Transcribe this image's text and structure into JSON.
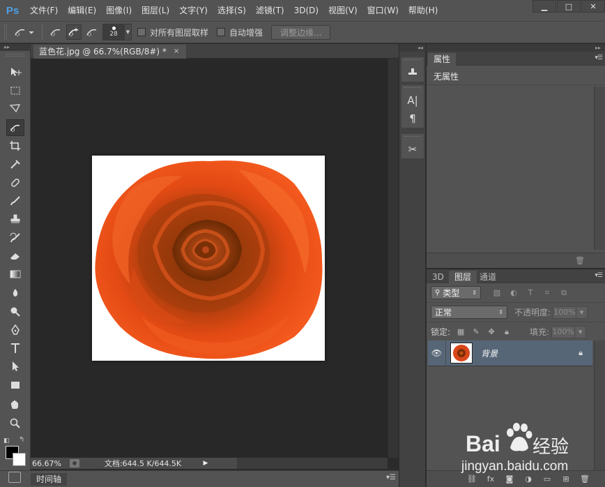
{
  "app": {
    "logo": "Ps"
  },
  "menu": [
    "文件(F)",
    "编辑(E)",
    "图像(I)",
    "图层(L)",
    "文字(Y)",
    "选择(S)",
    "滤镜(T)",
    "3D(D)",
    "视图(V)",
    "窗口(W)",
    "帮助(H)"
  ],
  "window_controls": {
    "minimize": "▁",
    "maximize": "□",
    "close": "✕"
  },
  "options": {
    "brush_size": "28",
    "sample_all_layers": "对所有图层取样",
    "auto_enhance": "自动增强",
    "refine_edge": "调整边缘..."
  },
  "document": {
    "tab_title": "蓝色花.jpg @ 66.7%(RGB/8#) *",
    "close": "×",
    "zoom": "66.67%",
    "doc_info": "文档:644.5 K/644.5K"
  },
  "timeline": {
    "label": "时间轴"
  },
  "properties": {
    "tab": "属性",
    "value": "无属性"
  },
  "layers": {
    "tabs": [
      "3D",
      "图层",
      "通道"
    ],
    "filter_label": "类型",
    "blend_mode": "正常",
    "opacity_label": "不透明度:",
    "opacity_value": "100%",
    "lock_label": "锁定:",
    "fill_label": "填充:",
    "fill_value": "100%",
    "items": [
      {
        "name": "背景",
        "visible": true,
        "locked": true
      }
    ]
  },
  "colors": {
    "accent": "#4fa0e8",
    "panel_bg": "#535353",
    "canvas_bg": "#282828",
    "selected_layer": "#576677"
  },
  "watermark": {
    "brand": "Bai",
    "brand2": "经验",
    "url": "jingyan.baidu.com"
  }
}
